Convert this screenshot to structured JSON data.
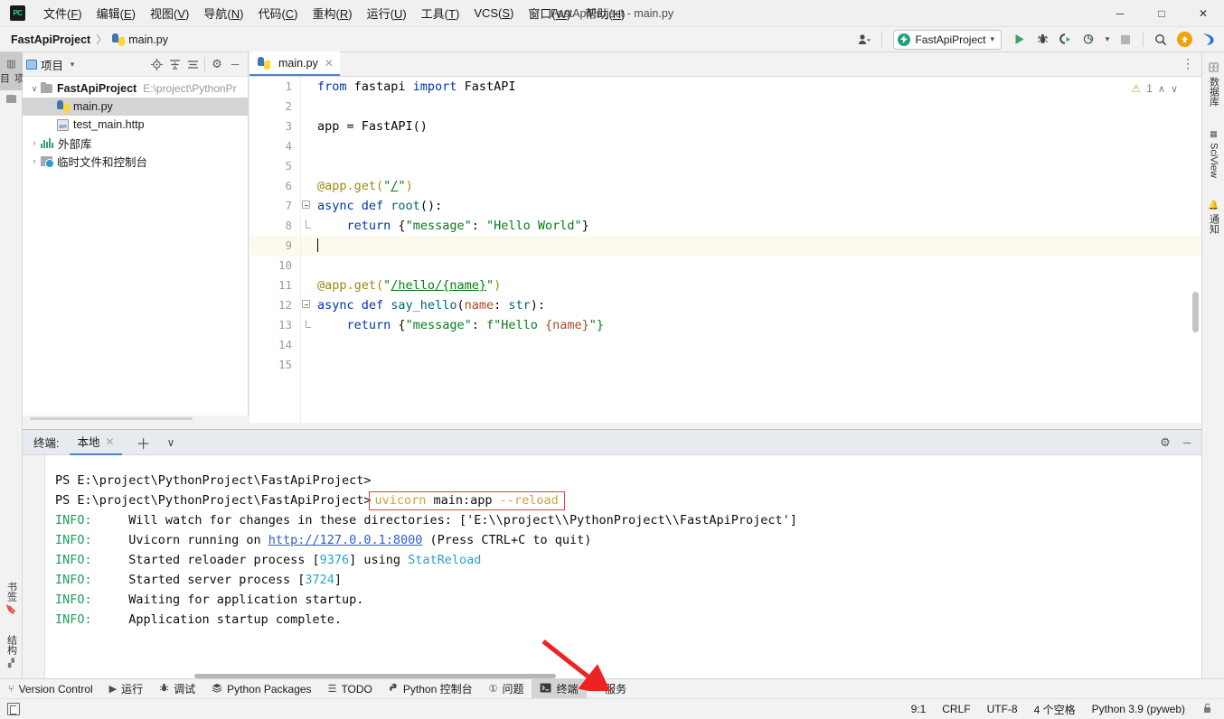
{
  "window": {
    "title": "FastApiProject - main.py",
    "logo_text": "PC",
    "minimize": "─",
    "maximize": "□",
    "close": "✕"
  },
  "menu": [
    {
      "label": "文件(F)",
      "name": "menu-file"
    },
    {
      "label": "编辑(E)",
      "name": "menu-edit"
    },
    {
      "label": "视图(V)",
      "name": "menu-view"
    },
    {
      "label": "导航(N)",
      "name": "menu-navigate"
    },
    {
      "label": "代码(C)",
      "name": "menu-code"
    },
    {
      "label": "重构(R)",
      "name": "menu-refactor"
    },
    {
      "label": "运行(U)",
      "name": "menu-run"
    },
    {
      "label": "工具(T)",
      "name": "menu-tools"
    },
    {
      "label": "VCS(S)",
      "name": "menu-vcs"
    },
    {
      "label": "窗口(W)",
      "name": "menu-window"
    },
    {
      "label": "帮助(H)",
      "name": "menu-help"
    }
  ],
  "breadcrumb": {
    "project": "FastApiProject",
    "separator": "〉",
    "file": "main.py"
  },
  "toolbar": {
    "account_icon": "user-icon",
    "run_config": "FastApiProject",
    "run_config_dot": "⚡",
    "chevron": "▾",
    "run": "▶",
    "debug": "bug-icon",
    "run_coverage": "run-coverage-icon",
    "profile": "profile-icon",
    "stop": "■",
    "search": "⌕",
    "update": "⬆",
    "ide_assistant": "assistant-icon"
  },
  "left_strip": [
    {
      "label": "项目",
      "name": "strip-tab-project",
      "active": true
    },
    {
      "label": "",
      "name": "strip-tab-commit",
      "active": false
    }
  ],
  "left_strip_bottom": [
    {
      "label": "书签",
      "name": "strip-tab-bookmarks"
    },
    {
      "label": "结构",
      "name": "strip-tab-structure"
    }
  ],
  "right_strip": [
    {
      "label": "数据库",
      "name": "strip-tab-database"
    },
    {
      "label": "SciView",
      "name": "strip-tab-sciview"
    },
    {
      "label": "通知",
      "name": "strip-tab-notifications"
    }
  ],
  "project_panel": {
    "title": "项目",
    "dropdown": "▾",
    "locate_icon": "⊕",
    "expand_icon": "expand-all-icon",
    "collapse_icon": "collapse-all-icon",
    "settings_icon": "⚙",
    "hide_icon": "─",
    "tree": [
      {
        "name": "tree-node-project",
        "label": "FastApiProject",
        "path": "E:\\project\\PythonPr",
        "depth": 0,
        "arrow": "∨",
        "icon": "folder",
        "bold": true,
        "selected": false
      },
      {
        "name": "tree-node-main-py",
        "label": "main.py",
        "path": "",
        "depth": 1,
        "arrow": "",
        "icon": "python",
        "bold": false,
        "selected": true
      },
      {
        "name": "tree-node-test-main-http",
        "label": "test_main.http",
        "path": "",
        "depth": 1,
        "arrow": "",
        "icon": "http",
        "bold": false,
        "selected": false
      },
      {
        "name": "tree-node-external-libraries",
        "label": "外部库",
        "path": "",
        "depth": 0,
        "arrow": "›",
        "icon": "library",
        "bold": false,
        "selected": false
      },
      {
        "name": "tree-node-scratches",
        "label": "临时文件和控制台",
        "path": "",
        "depth": 0,
        "arrow": "›",
        "icon": "scratch",
        "bold": false,
        "selected": false
      }
    ]
  },
  "editor": {
    "tab_label": "main.py",
    "tab_close": "✕",
    "options_icon": "⋮",
    "warning_count": "1",
    "warning_icon": "⚠",
    "prev_icon": "∧",
    "next_icon": "∨",
    "cursor_line": 9,
    "lines": [
      {
        "n": 1,
        "tokens": [
          {
            "t": "from",
            "c": "kw"
          },
          {
            "t": " fastapi ",
            "c": "plain"
          },
          {
            "t": "import",
            "c": "kw"
          },
          {
            "t": " FastAPI",
            "c": "plain"
          }
        ],
        "fold": ""
      },
      {
        "n": 2,
        "tokens": [],
        "fold": ""
      },
      {
        "n": 3,
        "tokens": [
          {
            "t": "app = FastAPI()",
            "c": "plain"
          }
        ],
        "fold": ""
      },
      {
        "n": 4,
        "tokens": [],
        "fold": ""
      },
      {
        "n": 5,
        "tokens": [],
        "fold": ""
      },
      {
        "n": 6,
        "tokens": [
          {
            "t": "@app.get(",
            "c": "deco"
          },
          {
            "t": "\"",
            "c": "str"
          },
          {
            "t": "/",
            "c": "str-ul"
          },
          {
            "t": "\"",
            "c": "str"
          },
          {
            "t": ")",
            "c": "deco"
          }
        ],
        "fold": ""
      },
      {
        "n": 7,
        "tokens": [
          {
            "t": "async def",
            "c": "kw"
          },
          {
            "t": " ",
            "c": "plain"
          },
          {
            "t": "root",
            "c": "fn"
          },
          {
            "t": "():",
            "c": "plain"
          }
        ],
        "fold": "start"
      },
      {
        "n": 8,
        "tokens": [
          {
            "t": "    ",
            "c": "plain"
          },
          {
            "t": "return",
            "c": "kw"
          },
          {
            "t": " {",
            "c": "plain"
          },
          {
            "t": "\"message\"",
            "c": "str"
          },
          {
            "t": ": ",
            "c": "plain"
          },
          {
            "t": "\"Hello World\"",
            "c": "str"
          },
          {
            "t": "}",
            "c": "plain"
          }
        ],
        "fold": "end"
      },
      {
        "n": 9,
        "tokens": [],
        "fold": "",
        "highlight": true
      },
      {
        "n": 10,
        "tokens": [],
        "fold": ""
      },
      {
        "n": 11,
        "tokens": [
          {
            "t": "@app.get(",
            "c": "deco"
          },
          {
            "t": "\"",
            "c": "str"
          },
          {
            "t": "/hello/{name}",
            "c": "str-ul"
          },
          {
            "t": "\"",
            "c": "str"
          },
          {
            "t": ")",
            "c": "deco"
          }
        ],
        "fold": ""
      },
      {
        "n": 12,
        "tokens": [
          {
            "t": "async def",
            "c": "kw"
          },
          {
            "t": " ",
            "c": "plain"
          },
          {
            "t": "say_hello",
            "c": "fn"
          },
          {
            "t": "(",
            "c": "plain"
          },
          {
            "t": "name",
            "c": "param"
          },
          {
            "t": ": ",
            "c": "plain"
          },
          {
            "t": "str",
            "c": "fn"
          },
          {
            "t": "):",
            "c": "plain"
          }
        ],
        "fold": "start"
      },
      {
        "n": 13,
        "tokens": [
          {
            "t": "    ",
            "c": "plain"
          },
          {
            "t": "return",
            "c": "kw"
          },
          {
            "t": " {",
            "c": "plain"
          },
          {
            "t": "\"message\"",
            "c": "str"
          },
          {
            "t": ": ",
            "c": "plain"
          },
          {
            "t": "f\"Hello ",
            "c": "str"
          },
          {
            "t": "{name}",
            "c": "param"
          },
          {
            "t": "\"}",
            "c": "str"
          }
        ],
        "fold": "end"
      },
      {
        "n": 14,
        "tokens": [],
        "fold": ""
      },
      {
        "n": 15,
        "tokens": [],
        "fold": ""
      }
    ]
  },
  "terminal": {
    "label": "终端:",
    "tab": "本地",
    "tab_close": "✕",
    "add": "＋",
    "chevron": "∨",
    "settings": "⚙",
    "hide": "─",
    "highlight_command": "uvicorn main:app --reload",
    "lines": [
      {
        "name": "terminal-line-prompt-1",
        "segments": [
          {
            "t": "PS E:\\project\\PythonProject\\FastApiProject>",
            "c": "t-white"
          }
        ]
      },
      {
        "name": "terminal-line-command",
        "segments": [
          {
            "t": "PS E:\\project\\PythonProject\\FastApiProject>",
            "c": "t-white"
          },
          {
            "t": "BOX",
            "c": "box"
          }
        ]
      },
      {
        "name": "terminal-line-info-watch",
        "segments": [
          {
            "t": "INFO:",
            "c": "t-info"
          },
          {
            "t": "     Will watch for changes in these directories: ['E:\\\\project\\\\PythonProject\\\\FastApiProject']",
            "c": "t-white"
          }
        ]
      },
      {
        "name": "terminal-line-info-running",
        "segments": [
          {
            "t": "INFO:",
            "c": "t-info"
          },
          {
            "t": "     Uvicorn running on ",
            "c": "t-white"
          },
          {
            "t": "http://127.0.0.1:8000",
            "c": "t-link"
          },
          {
            "t": " (Press CTRL+C to quit)",
            "c": "t-white"
          }
        ]
      },
      {
        "name": "terminal-line-info-reloader",
        "segments": [
          {
            "t": "INFO:",
            "c": "t-info"
          },
          {
            "t": "     Started reloader process [",
            "c": "t-white"
          },
          {
            "t": "9376",
            "c": "t-num"
          },
          {
            "t": "] using ",
            "c": "t-white"
          },
          {
            "t": "StatReload",
            "c": "t-cyan"
          }
        ]
      },
      {
        "name": "terminal-line-info-server",
        "segments": [
          {
            "t": "INFO:",
            "c": "t-info"
          },
          {
            "t": "     Started server process [",
            "c": "t-white"
          },
          {
            "t": "3724",
            "c": "t-num"
          },
          {
            "t": "]",
            "c": "t-white"
          }
        ]
      },
      {
        "name": "terminal-line-info-waiting",
        "segments": [
          {
            "t": "INFO:",
            "c": "t-info"
          },
          {
            "t": "     Waiting for application startup.",
            "c": "t-white"
          }
        ]
      },
      {
        "name": "terminal-line-info-complete",
        "segments": [
          {
            "t": "INFO:",
            "c": "t-info"
          },
          {
            "t": "     Application startup complete.",
            "c": "t-white"
          }
        ]
      }
    ]
  },
  "command_parts": [
    {
      "t": "uvicorn ",
      "c": "t-cmd"
    },
    {
      "t": "main:app ",
      "c": "t-white"
    },
    {
      "t": "--reload",
      "c": "t-cmd"
    }
  ],
  "bottom_bar": [
    {
      "name": "bottom-tool-version-control",
      "icon": "⑂",
      "label": "Version Control",
      "active": false
    },
    {
      "name": "bottom-tool-run",
      "icon": "▶",
      "label": "运行",
      "active": false
    },
    {
      "name": "bottom-tool-debug",
      "icon": "bug-icon",
      "label": "调试",
      "active": false
    },
    {
      "name": "bottom-tool-python-packages",
      "icon": "stack-icon",
      "label": "Python Packages",
      "active": false
    },
    {
      "name": "bottom-tool-todo",
      "icon": "☰",
      "label": "TODO",
      "active": false
    },
    {
      "name": "bottom-tool-python-console",
      "icon": "python-icon",
      "label": "Python 控制台",
      "active": false
    },
    {
      "name": "bottom-tool-problems",
      "icon": "①",
      "label": "问题",
      "active": false
    },
    {
      "name": "bottom-tool-terminal",
      "icon": "terminal-icon",
      "label": "终端",
      "active": true
    },
    {
      "name": "bottom-tool-services",
      "icon": "◐",
      "label": "服务",
      "active": false
    }
  ],
  "status_bar": {
    "caret_position": "9:1",
    "line_separator": "CRLF",
    "encoding": "UTF-8",
    "indent": "4 个空格",
    "interpreter": "Python 3.9 (pyweb)",
    "lock_icon": "🔓"
  },
  "annotation": {
    "arrow_color": "#ee2222",
    "points_to": "bottom-tool-terminal"
  },
  "colors": {
    "accent_blue": "#4a86c8",
    "green_run": "#3aa06c",
    "keyword": "#0033b3",
    "string": "#067d17",
    "decorator": "#9e880d",
    "terminal_info": "#1a9e5e",
    "annotation_red": "#ee2222"
  }
}
